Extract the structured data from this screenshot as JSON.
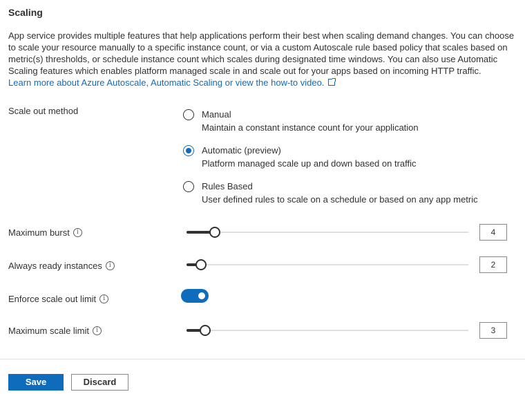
{
  "section": {
    "title": "Scaling",
    "description": "App service provides multiple features that help applications perform their best when scaling demand changes. You can choose to scale your resource manually to a specific instance count, or via a custom Autoscale rule based policy that scales based on metric(s) thresholds, or schedule instance count which scales during designated time windows. You can also use Automatic Scaling features which enables platform managed scale in and scale out for your apps based on incoming HTTP traffic.",
    "learn_more_link": "Learn more about Azure Autoscale, Automatic Scaling or view the how-to video."
  },
  "scale_out_method": {
    "label": "Scale out method",
    "selected": "Automatic (preview)",
    "options": [
      {
        "label": "Manual",
        "description": "Maintain a constant instance count for your application"
      },
      {
        "label": "Automatic (preview)",
        "description": "Platform managed scale up and down based on traffic"
      },
      {
        "label": "Rules Based",
        "description": "User defined rules to scale on a schedule or based on any app metric"
      }
    ]
  },
  "maximum_burst": {
    "label": "Maximum burst",
    "value": "4"
  },
  "always_ready_instances": {
    "label": "Always ready instances",
    "value": "2"
  },
  "enforce_scale_out_limit": {
    "label": "Enforce scale out limit",
    "enabled": true
  },
  "maximum_scale_limit": {
    "label": "Maximum scale limit",
    "value": "3"
  },
  "footer": {
    "save_label": "Save",
    "discard_label": "Discard"
  },
  "icons": {
    "info": "info-icon",
    "external_link": "external-link-icon"
  },
  "colors": {
    "accent": "#0f6cbd",
    "text": "#323130",
    "track": "#e1dfdd"
  }
}
